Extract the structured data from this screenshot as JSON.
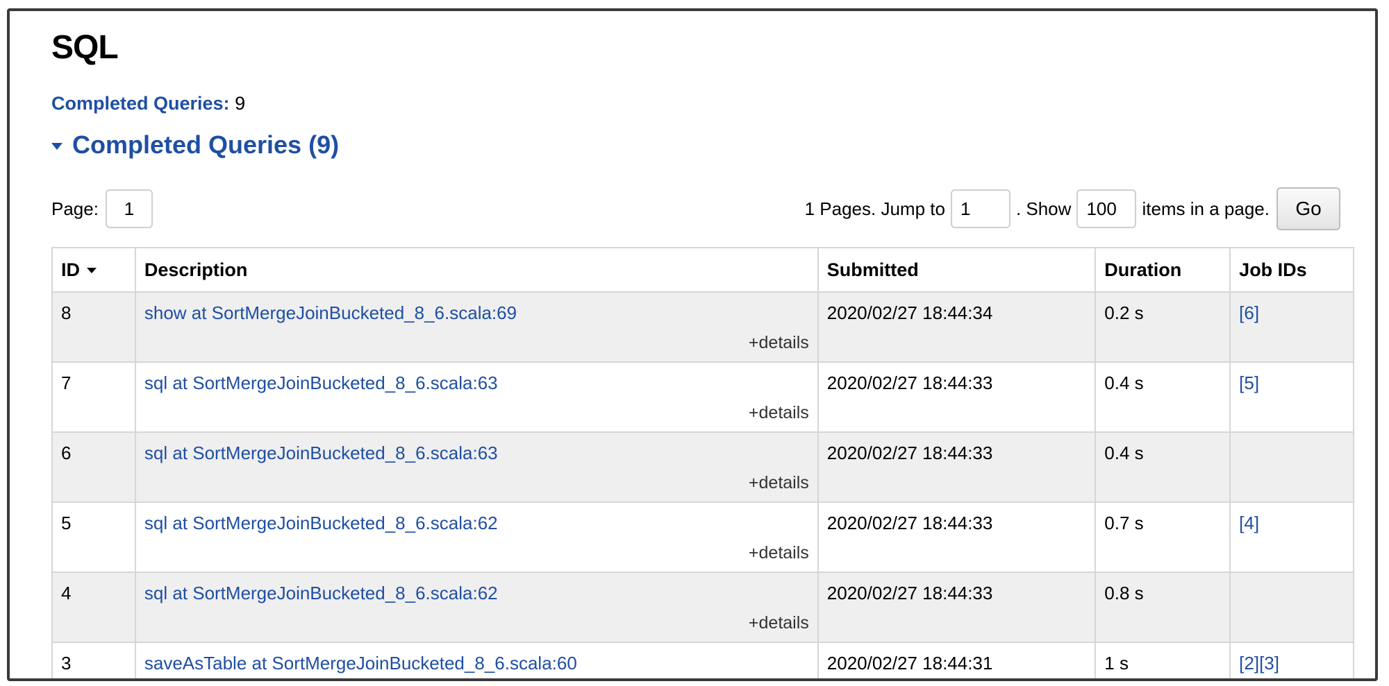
{
  "header": {
    "title": "SQL"
  },
  "summary": {
    "label": "Completed Queries:",
    "value": "9"
  },
  "section": {
    "title": "Completed Queries (9)"
  },
  "pager": {
    "page_label": "Page:",
    "page_value": "1",
    "pages_text": "1 Pages. Jump to",
    "jump_value": "1",
    "show_text": ". Show",
    "show_value": "100",
    "items_text": "items in a page.",
    "go_label": "Go"
  },
  "table": {
    "columns": [
      "ID",
      "Description",
      "Submitted",
      "Duration",
      "Job IDs"
    ],
    "details_label": "+details",
    "rows": [
      {
        "id": "8",
        "description": "show at SortMergeJoinBucketed_8_6.scala:69",
        "submitted": "2020/02/27 18:44:34",
        "duration": "0.2 s",
        "job_ids": "[6]"
      },
      {
        "id": "7",
        "description": "sql at SortMergeJoinBucketed_8_6.scala:63",
        "submitted": "2020/02/27 18:44:33",
        "duration": "0.4 s",
        "job_ids": "[5]"
      },
      {
        "id": "6",
        "description": "sql at SortMergeJoinBucketed_8_6.scala:63",
        "submitted": "2020/02/27 18:44:33",
        "duration": "0.4 s",
        "job_ids": ""
      },
      {
        "id": "5",
        "description": "sql at SortMergeJoinBucketed_8_6.scala:62",
        "submitted": "2020/02/27 18:44:33",
        "duration": "0.7 s",
        "job_ids": "[4]"
      },
      {
        "id": "4",
        "description": "sql at SortMergeJoinBucketed_8_6.scala:62",
        "submitted": "2020/02/27 18:44:33",
        "duration": "0.8 s",
        "job_ids": ""
      },
      {
        "id": "3",
        "description": "saveAsTable at SortMergeJoinBucketed_8_6.scala:60",
        "submitted": "2020/02/27 18:44:31",
        "duration": "1 s",
        "job_ids": "[2][3]"
      }
    ]
  },
  "colors": {
    "link": "#1f4fa3",
    "row_alt": "#efefef",
    "border": "#d6d6d6"
  }
}
